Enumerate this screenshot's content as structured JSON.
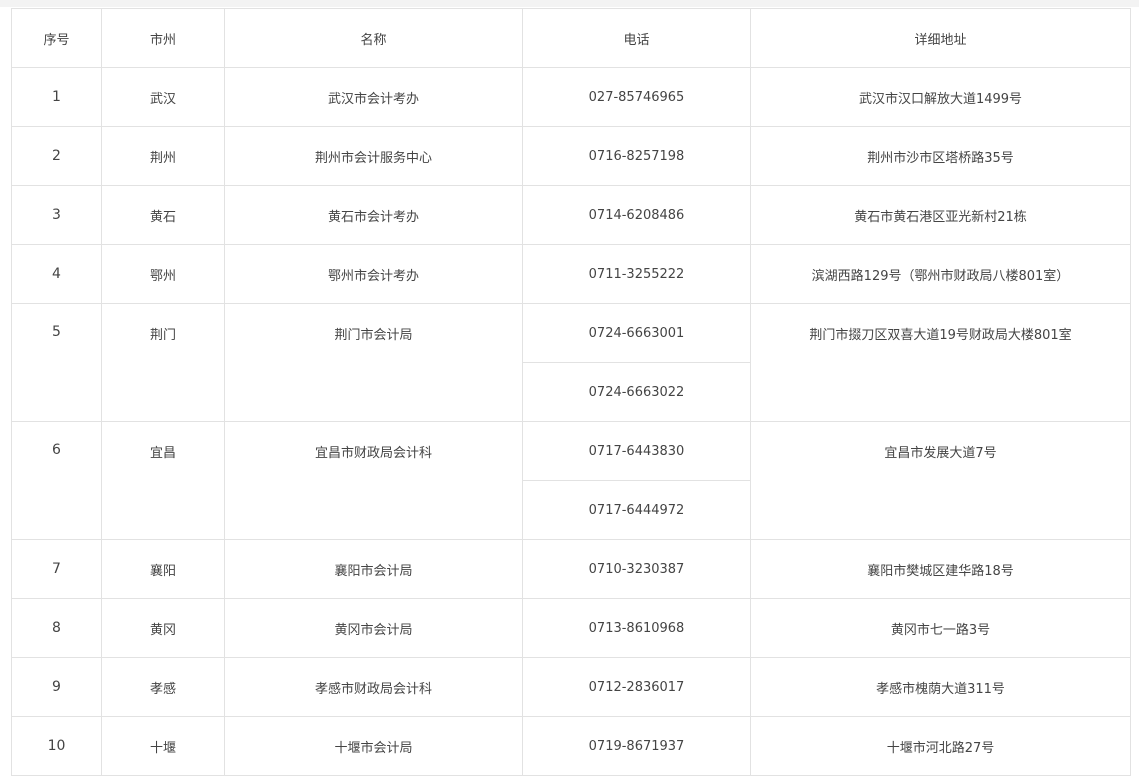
{
  "headers": [
    "序号",
    "市州",
    "名称",
    "电话",
    "详细地址"
  ],
  "rows": [
    {
      "no": "1",
      "city": "武汉",
      "name": "武汉市会计考办",
      "phones": [
        "027-85746965"
      ],
      "address": "武汉市汉口解放大道1499号"
    },
    {
      "no": "2",
      "city": "荆州",
      "name": "荆州市会计服务中心",
      "phones": [
        "0716-8257198"
      ],
      "address": "荆州市沙市区塔桥路35号"
    },
    {
      "no": "3",
      "city": "黄石",
      "name": "黄石市会计考办",
      "phones": [
        "0714-6208486"
      ],
      "address": "黄石市黄石港区亚光新村21栋"
    },
    {
      "no": "4",
      "city": "鄂州",
      "name": "鄂州市会计考办",
      "phones": [
        "0711-3255222"
      ],
      "address": "滨湖西路129号（鄂州市财政局八楼801室）"
    },
    {
      "no": "5",
      "city": "荆门",
      "name": "荆门市会计局",
      "phones": [
        "0724-6663001",
        "0724-6663022"
      ],
      "address": "荆门市掇刀区双喜大道19号财政局大楼801室"
    },
    {
      "no": "6",
      "city": "宜昌",
      "name": "宜昌市财政局会计科",
      "phones": [
        "0717-6443830",
        "0717-6444972"
      ],
      "address": "宜昌市发展大道7号"
    },
    {
      "no": "7",
      "city": "襄阳",
      "name": "襄阳市会计局",
      "phones": [
        "0710-3230387"
      ],
      "address": "襄阳市樊城区建华路18号"
    },
    {
      "no": "8",
      "city": "黄冈",
      "name": "黄冈市会计局",
      "phones": [
        "0713-8610968"
      ],
      "address": "黄冈市七一路3号"
    },
    {
      "no": "9",
      "city": "孝感",
      "name": "孝感市财政局会计科",
      "phones": [
        "0712-2836017"
      ],
      "address": "孝感市槐荫大道311号"
    },
    {
      "no": "10",
      "city": "十堰",
      "name": "十堰市会计局",
      "phones": [
        "0719-8671937"
      ],
      "address": "十堰市河北路27号"
    }
  ]
}
